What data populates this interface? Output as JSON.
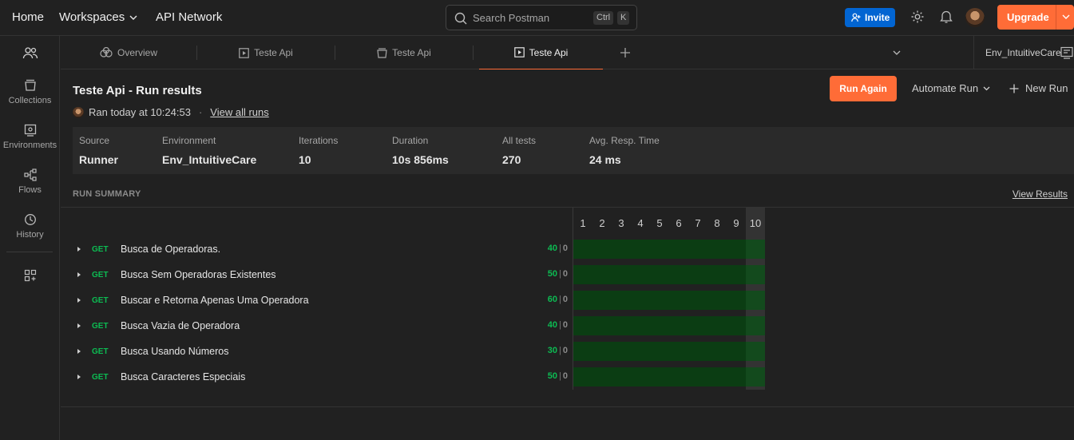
{
  "header": {
    "home": "Home",
    "workspaces": "Workspaces",
    "api_network": "API Network",
    "search_placeholder": "Search Postman",
    "kbd_ctrl": "Ctrl",
    "kbd_k": "K",
    "invite": "Invite",
    "upgrade": "Upgrade"
  },
  "sidebar": {
    "items": [
      {
        "label": "Collections",
        "icon": "collections-icon"
      },
      {
        "label": "Environments",
        "icon": "environments-icon"
      },
      {
        "label": "Flows",
        "icon": "flows-icon"
      },
      {
        "label": "History",
        "icon": "history-icon"
      }
    ]
  },
  "tabs": [
    {
      "label": "Overview",
      "icon": "overview-icon",
      "active": false
    },
    {
      "label": "Teste Api",
      "icon": "runner-icon",
      "active": false
    },
    {
      "label": "Teste Api",
      "icon": "collection-icon",
      "active": false
    },
    {
      "label": "Teste Api",
      "icon": "runner-icon",
      "active": true
    }
  ],
  "environment_selector": "Env_IntuitiveCare",
  "run": {
    "title": "Teste Api - Run results",
    "ran_at": "Ran today at 10:24:53",
    "view_all_runs": "View all runs",
    "run_again": "Run Again",
    "automate_run": "Automate Run",
    "new_run": "New Run"
  },
  "stats": [
    {
      "key": "Source",
      "value": "Runner"
    },
    {
      "key": "Environment",
      "value": "Env_IntuitiveCare"
    },
    {
      "key": "Iterations",
      "value": "10"
    },
    {
      "key": "Duration",
      "value": "10s 856ms"
    },
    {
      "key": "All tests",
      "value": "270"
    },
    {
      "key": "Avg. Resp. Time",
      "value": "24 ms"
    }
  ],
  "summary": {
    "label": "RUN SUMMARY",
    "view_results": "View Results",
    "iterations": [
      "1",
      "2",
      "3",
      "4",
      "5",
      "6",
      "7",
      "8",
      "9",
      "10"
    ],
    "highlighted_iteration": "10",
    "colors": {
      "pass_bar": "#0b3d13",
      "pass_text": "#0cbb52",
      "accent": "#ff6c37"
    },
    "requests": [
      {
        "method": "GET",
        "name": "Busca de Operadoras.",
        "passed": "40",
        "sep": "|",
        "failed": "0"
      },
      {
        "method": "GET",
        "name": "Busca Sem Operadoras Existentes",
        "passed": "50",
        "sep": "|",
        "failed": "0"
      },
      {
        "method": "GET",
        "name": "Buscar e Retorna Apenas Uma Operadora",
        "passed": "60",
        "sep": "|",
        "failed": "0"
      },
      {
        "method": "GET",
        "name": "Busca Vazia de Operadora",
        "passed": "40",
        "sep": "|",
        "failed": "0"
      },
      {
        "method": "GET",
        "name": "Busca Usando Números",
        "passed": "30",
        "sep": "|",
        "failed": "0"
      },
      {
        "method": "GET",
        "name": "Busca Caracteres Especiais",
        "passed": "50",
        "sep": "|",
        "failed": "0"
      }
    ]
  }
}
